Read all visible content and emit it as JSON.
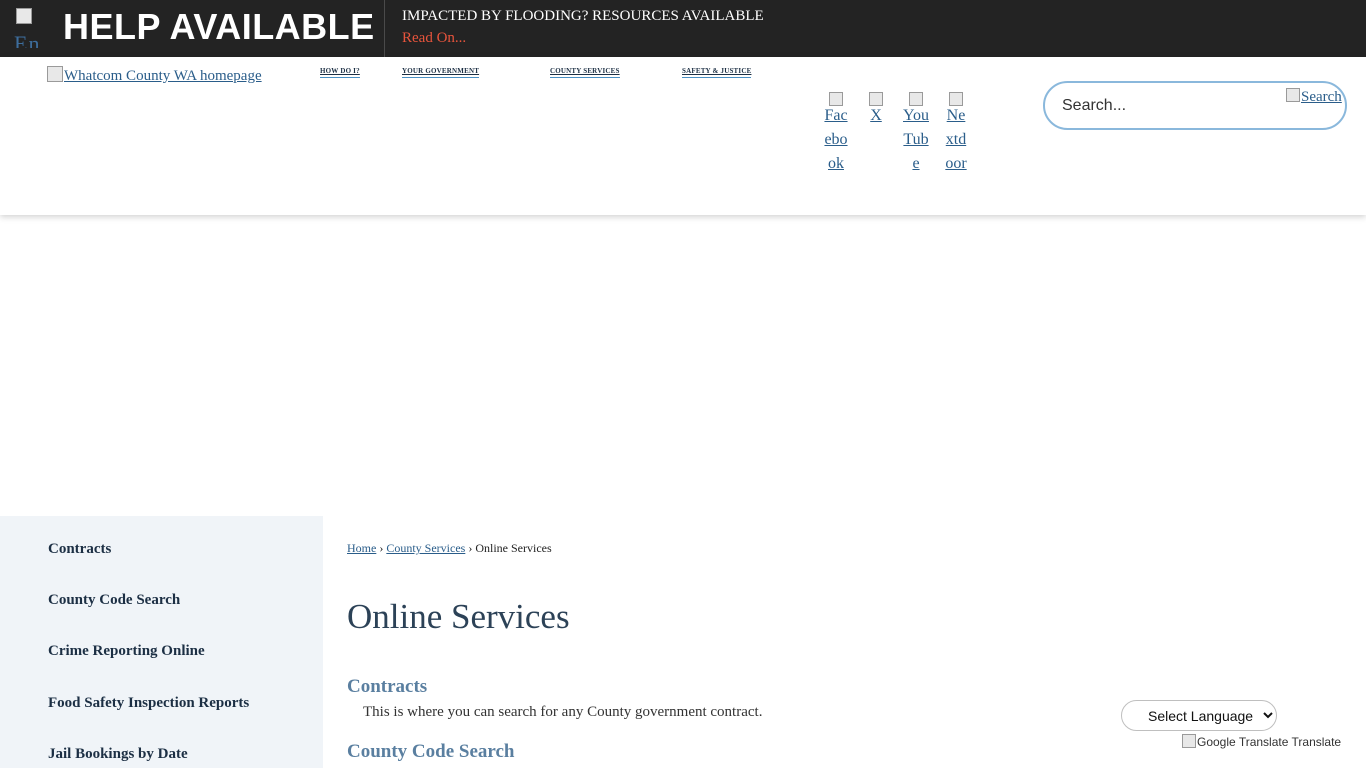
{
  "alert": {
    "icon_alt": "En",
    "title": "HELP AVAILABLE",
    "heading": "IMPACTED BY FLOODING? RESOURCES AVAILABLE",
    "link": "Read On..."
  },
  "header": {
    "logo_alt": "Whatcom County WA homepage",
    "nav": [
      "HOW DO I?",
      "YOUR GOVERNMENT",
      "COUNTY SERVICES",
      "SAFETY & JUSTICE"
    ],
    "social": [
      "Facebook",
      "X",
      "YouTube",
      "Nextdoor"
    ],
    "search": {
      "placeholder": "Search...",
      "button_alt": "Search"
    }
  },
  "sidebar": {
    "items": [
      "Contracts",
      "County Code Search",
      "Crime Reporting Online",
      "Food Safety Inspection Reports",
      "Jail Bookings by Date"
    ]
  },
  "breadcrumb": {
    "home": "Home",
    "parent": "County Services",
    "current": "Online Services",
    "separator": "›"
  },
  "main": {
    "title": "Online Services",
    "sections": [
      {
        "title": "Contracts",
        "description": "This is where you can search for any County government contract."
      },
      {
        "title": "County Code Search"
      }
    ]
  },
  "translate": {
    "select_label": "Select Language",
    "powered_alt": "Google Translate",
    "powered_text": "Translate"
  }
}
